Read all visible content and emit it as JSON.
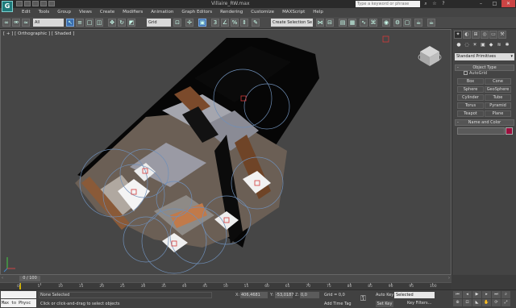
{
  "titlebar": {
    "logo": "G",
    "title": "Villaire_RW.max",
    "search_placeholder": "Type a keyword or phrase",
    "win_min": "–",
    "win_max": "□",
    "win_close": "✕"
  },
  "menu": [
    "Edit",
    "Tools",
    "Group",
    "Views",
    "Create",
    "Modifiers",
    "Animation",
    "Graph Editors",
    "Rendering",
    "Customize",
    "MAXScript",
    "Help"
  ],
  "toolbar": {
    "filter_value": "All",
    "selection_set": "Create Selection Se",
    "view_value": "Grid"
  },
  "viewport": {
    "label": "[ + ] [ Orthographic ] [ Shaded ]"
  },
  "command_panel": {
    "dropdown": "Standard Primitives",
    "object_type_title": "Object Type",
    "autogrid": "AutoGrid",
    "buttons": [
      "Box",
      "Cone",
      "Sphere",
      "GeoSphere",
      "Cylinder",
      "Tube",
      "Torus",
      "Pyramid",
      "Teapot",
      "Plane"
    ],
    "name_color_title": "Name and Color",
    "swatch_color": "#9c0f3e"
  },
  "timeline": {
    "frame_counter": "0 / 100",
    "ticks": [
      "0",
      "5",
      "10",
      "15",
      "20",
      "25",
      "30",
      "35",
      "40",
      "45",
      "50",
      "55",
      "60",
      "65",
      "70",
      "75",
      "80",
      "85",
      "90",
      "95",
      "100"
    ]
  },
  "status": {
    "maxscript_text": "Max to Physc",
    "selected": "None Selected",
    "prompt": "Click or click-and-drag to select objects",
    "x_label": "X:",
    "x_value": "406,4681",
    "y_label": "Y:",
    "y_value": "-53,0187",
    "z_label": "Z:",
    "z_value": "0,0",
    "grid": "Grid = 0,0",
    "add_time_tag": "Add Time Tag",
    "auto_key": "Auto Key",
    "selected_dropdown": "Selected",
    "set_key": "Set Key",
    "key_filters": "Key Filters..."
  }
}
